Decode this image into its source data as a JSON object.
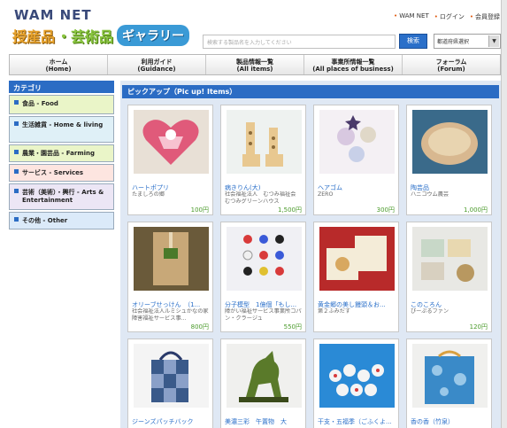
{
  "header": {
    "logo_main": "WAM NET",
    "logo_part1": "授産品",
    "logo_part2": "・芸術品",
    "logo_part3": "ギャラリー",
    "links": [
      "WAM NET",
      "ログイン",
      "会員登録"
    ],
    "search_placeholder": "検索する製品名を入力してください",
    "search_button": "検索",
    "pref_select": "都道府県選択"
  },
  "nav": [
    {
      "jp": "ホーム",
      "en": "(Home)"
    },
    {
      "jp": "利用ガイド",
      "en": "(Guidance)"
    },
    {
      "jp": "製品情報一覧",
      "en": "(All items)"
    },
    {
      "jp": "事業所情報一覧",
      "en": "(All places of business)"
    },
    {
      "jp": "フォーラム",
      "en": "(Forum)"
    }
  ],
  "sidebar": {
    "title": "カテゴリ",
    "items": [
      {
        "label": "食品 - Food"
      },
      {
        "label": "生活雑貨 - Home & living"
      },
      {
        "label": "農業・園芸品 - Farming"
      },
      {
        "label": "サービス - Services"
      },
      {
        "label": "芸術（美術）・興行 - Arts & Entertainment"
      },
      {
        "label": "その他 - Other"
      }
    ]
  },
  "main": {
    "pickup_title": "ピックアップ（Pic up! Items）",
    "cards": [
      {
        "name": "ハートポプリ",
        "org": "たましろの郷",
        "price": "100円"
      },
      {
        "name": "病きりん(大)",
        "org": "社会福祉法人　むつみ福祉会　むつみグリーンハウス",
        "price": "1,500円"
      },
      {
        "name": "ヘアゴム",
        "org": "ZERO",
        "price": "300円"
      },
      {
        "name": "陶芸品",
        "org": "ハニコウム農芸",
        "price": "1,000円"
      },
      {
        "name": "オリーブせっけん　（1...",
        "org": "社会福祉法人ルミシュかなの家　障害福祉サービス事...",
        "price": "800円"
      },
      {
        "name": "分子模型　1億個「もし...",
        "org": "障がい福祉サービス事業所コパン・クラージュ",
        "price": "550円"
      },
      {
        "name": "黄金郷の美し饅頭＆お...",
        "org": "第２ふみだす",
        "price": ""
      },
      {
        "name": "このころん",
        "org": "ぴーぷるファン",
        "price": "120円"
      },
      {
        "name": "ジーンズパッチバック",
        "org": "",
        "price": ""
      },
      {
        "name": "美濃三彩　午置物　大",
        "org": "",
        "price": ""
      },
      {
        "name": "干支・五福季（ごふくよ...",
        "org": "",
        "price": ""
      },
      {
        "name": "香の香（竹泉）",
        "org": "",
        "price": ""
      }
    ]
  },
  "colors": {
    "accent_blue": "#2b6cc4",
    "price_green": "#4a9a2a",
    "link_blue": "#2a6fc9"
  }
}
